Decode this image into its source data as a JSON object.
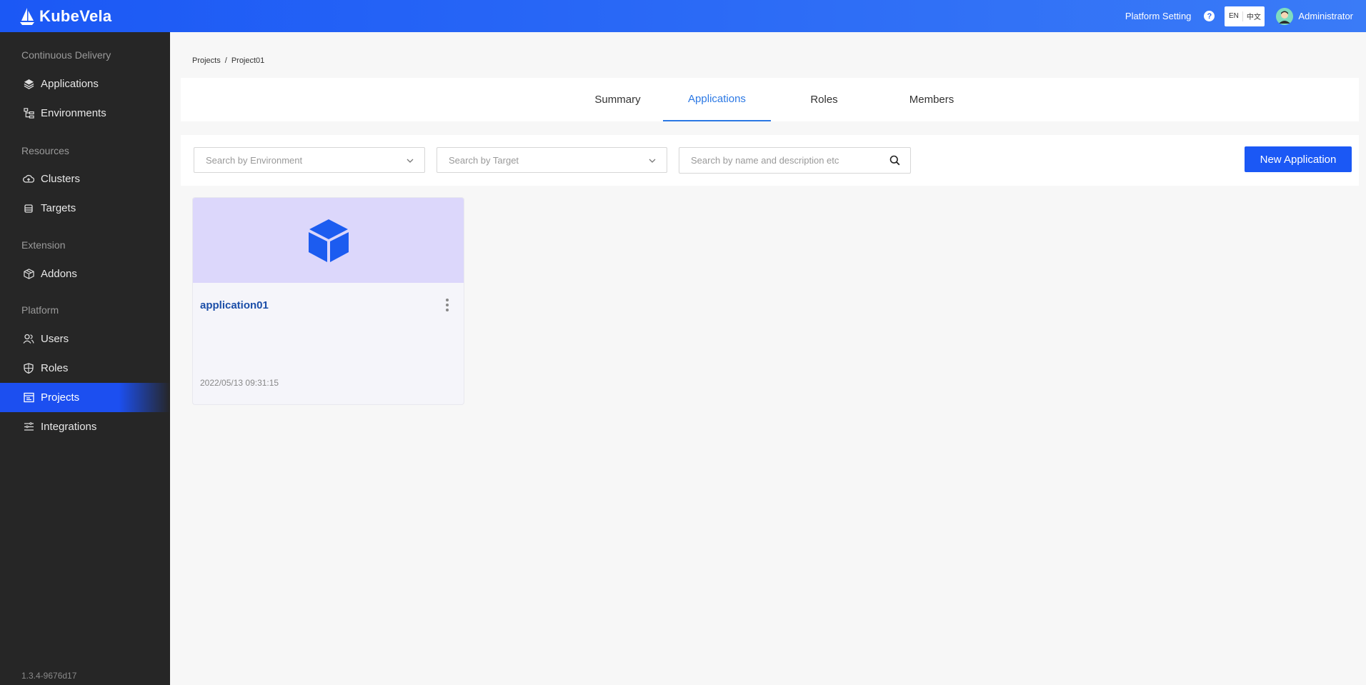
{
  "header": {
    "brand": "KubeVela",
    "platform_setting": "Platform Setting",
    "help": "?",
    "lang_en": "EN",
    "lang_zh": "中文",
    "username": "Administrator",
    "colors": {
      "bar": "#1b58f5",
      "active": "#2b78e4"
    }
  },
  "sidebar": {
    "groups": {
      "delivery": "Continuous Delivery",
      "resources": "Resources",
      "extension": "Extension",
      "platform": "Platform"
    },
    "items": {
      "applications": "Applications",
      "environments": "Environments",
      "clusters": "Clusters",
      "targets": "Targets",
      "addons": "Addons",
      "users": "Users",
      "roles": "Roles",
      "projects": "Projects",
      "integrations": "Integrations"
    },
    "active": "Projects",
    "version": "1.3.4-9676d17"
  },
  "breadcrumb": {
    "root": "Projects",
    "separator": "/",
    "current": "Project01"
  },
  "tabs": {
    "summary": "Summary",
    "applications": "Applications",
    "roles": "Roles",
    "members": "Members",
    "active": "Applications"
  },
  "filters": {
    "environment_placeholder": "Search by Environment",
    "target_placeholder": "Search by Target",
    "search_placeholder": "Search by name and description etc",
    "new_application": "New Application"
  },
  "applications": [
    {
      "name": "application01",
      "created": "2022/05/13 09:31:15"
    }
  ]
}
